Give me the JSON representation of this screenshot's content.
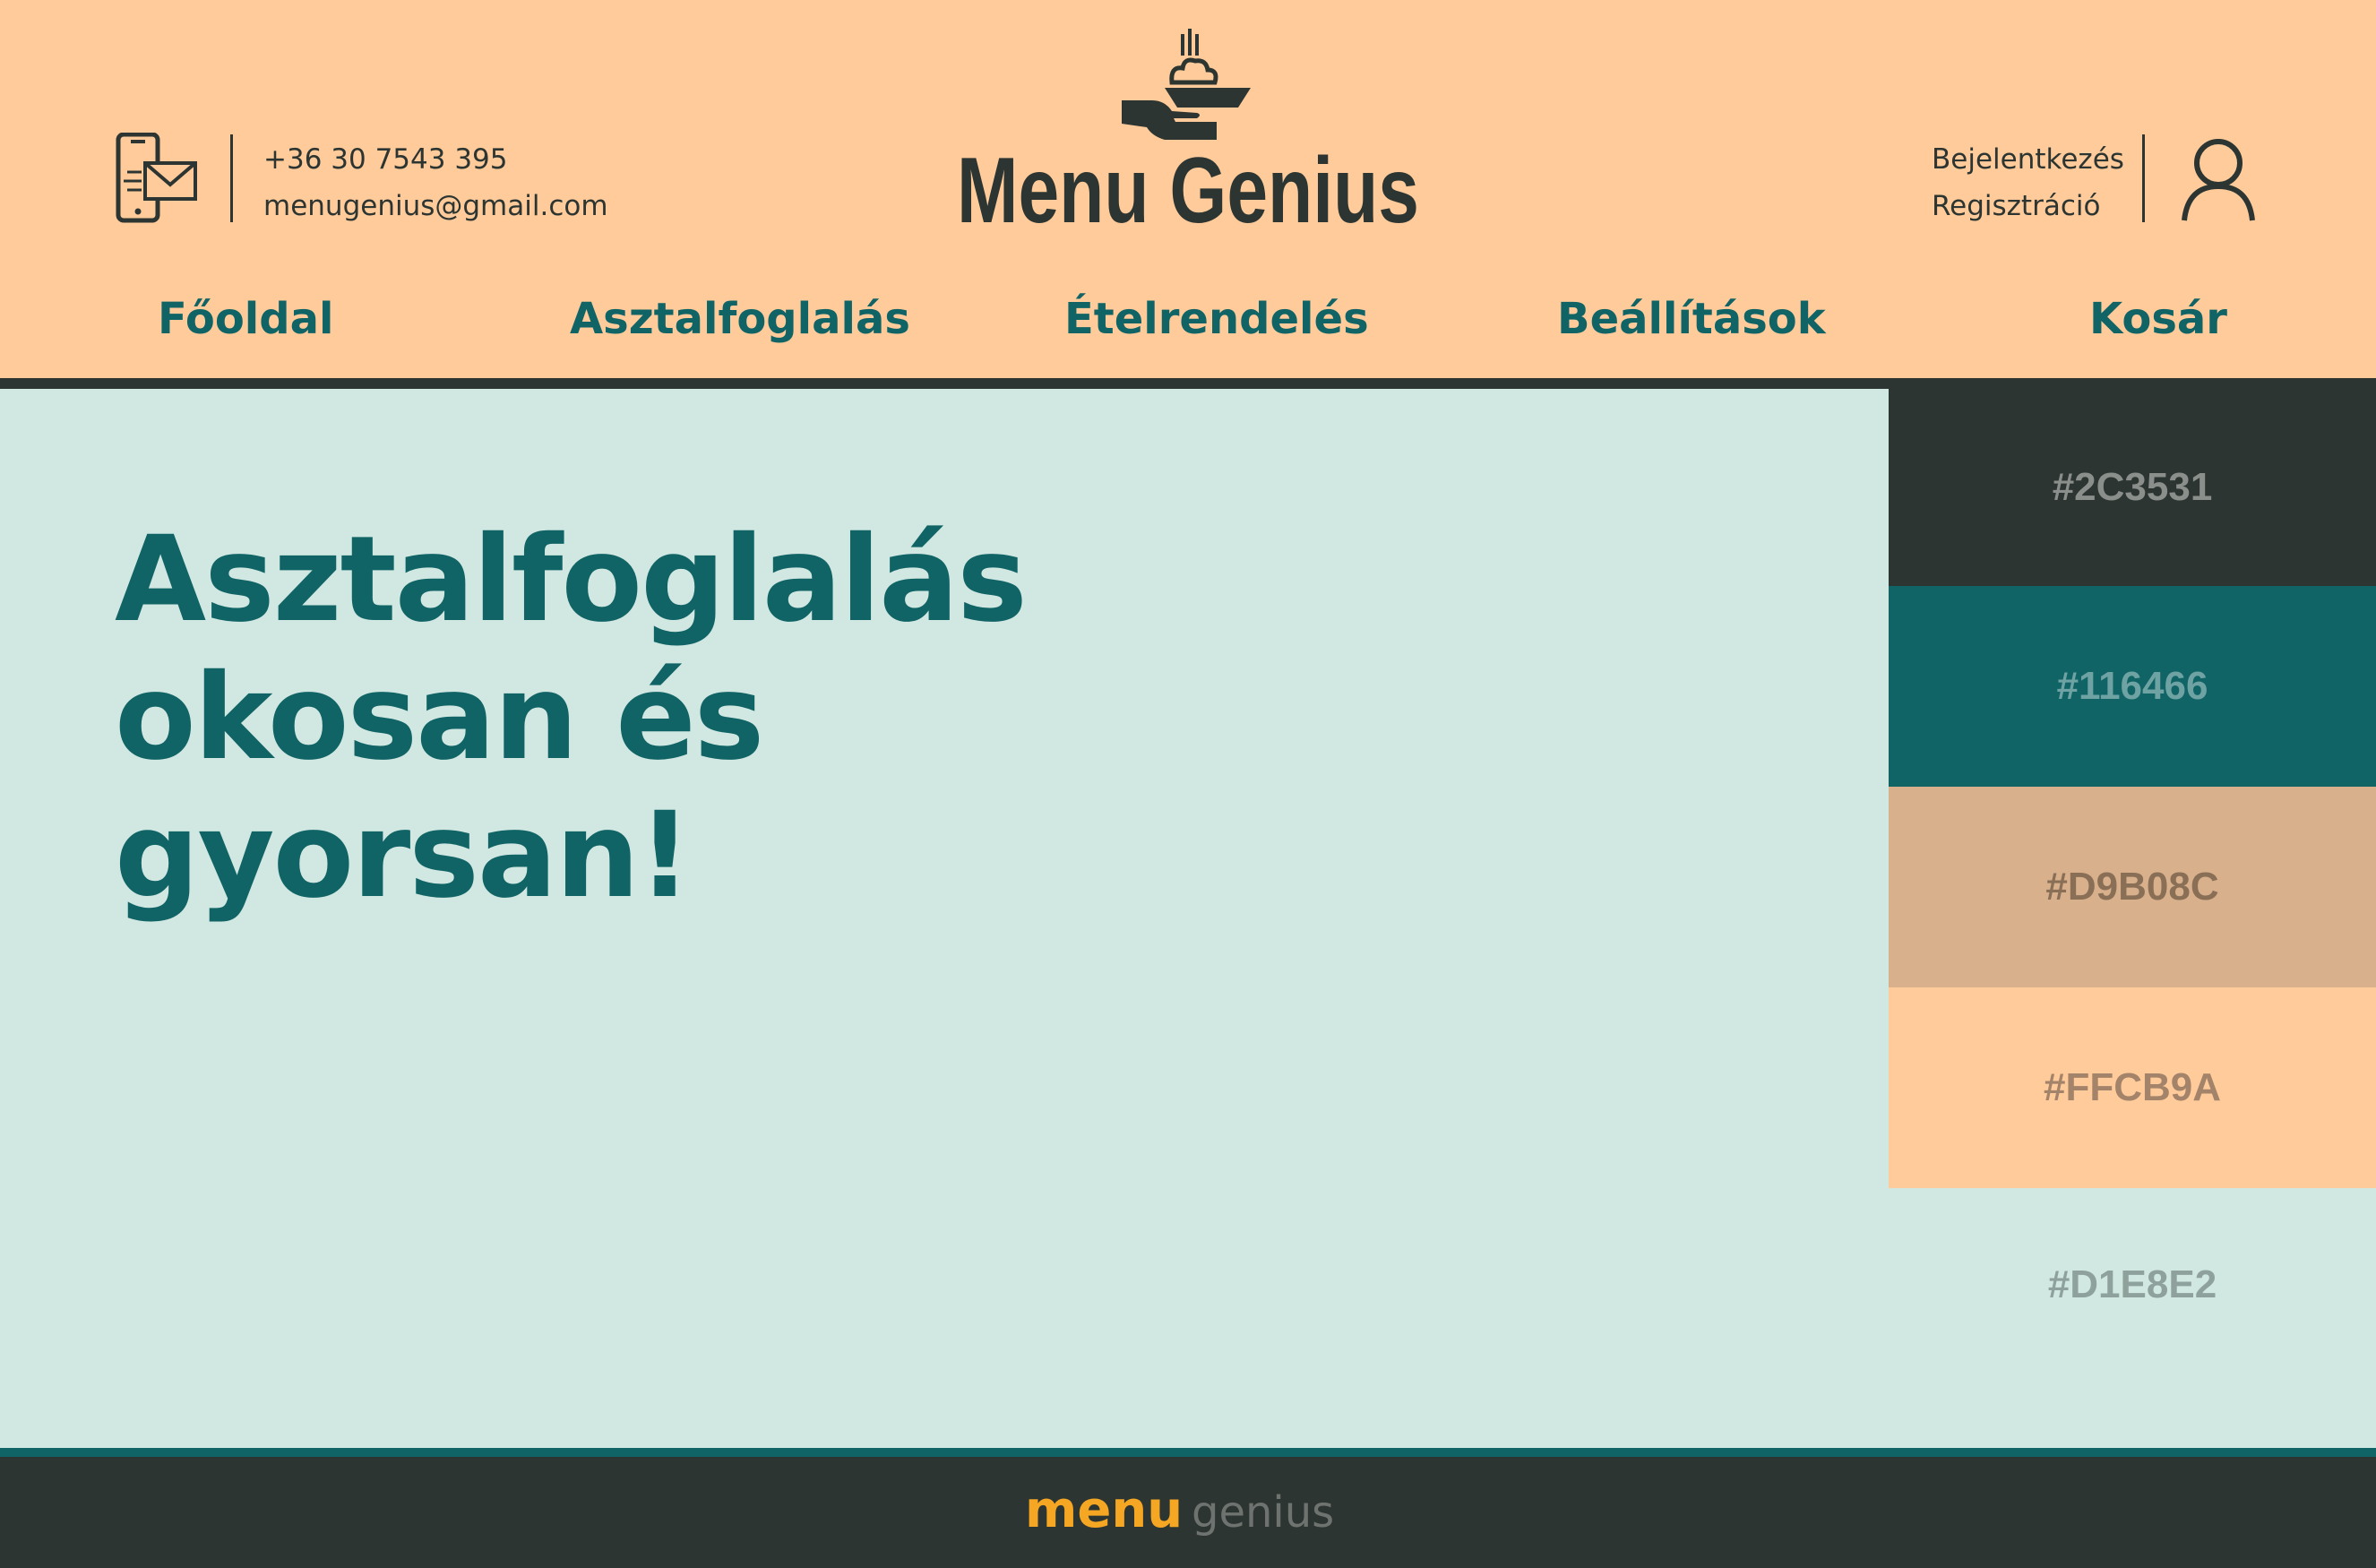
{
  "header": {
    "phone": "+36 30 7543 395",
    "email": "menugenius@gmail.com",
    "brand": "Menu Genius",
    "login": "Bejelentkezés",
    "register": "Regisztráció"
  },
  "nav": {
    "items": [
      {
        "label": "Főoldal"
      },
      {
        "label": "Asztalfoglalás"
      },
      {
        "label": "Ételrendelés"
      },
      {
        "label": "Beállítások"
      },
      {
        "label": "Kosár"
      }
    ]
  },
  "hero": {
    "line1": "Asztalfoglalás",
    "line2": "okosan és",
    "line3": "gyorsan!"
  },
  "palette": [
    {
      "label": "#2C3531",
      "color": "#2C3531",
      "text_color": "#8A8F8C"
    },
    {
      "label": "#116466",
      "color": "#116466",
      "text_color": "#6FA2A3"
    },
    {
      "label": "#D9B08C",
      "color": "#D9B08C",
      "text_color": "#8A6F57"
    },
    {
      "label": "#FFCB9A",
      "color": "#FFCB9A",
      "text_color": "#A38369"
    },
    {
      "label": "#D1E8E2",
      "color": "#D1E8E2",
      "text_color": "#8FA19C"
    }
  ],
  "footer": {
    "logo_part1": "menu",
    "logo_part2": "genius",
    "accent": "#F5A623"
  },
  "icons": {
    "contact": "phone-mail-icon",
    "logo": "serving-hand-icon",
    "user": "user-icon"
  }
}
